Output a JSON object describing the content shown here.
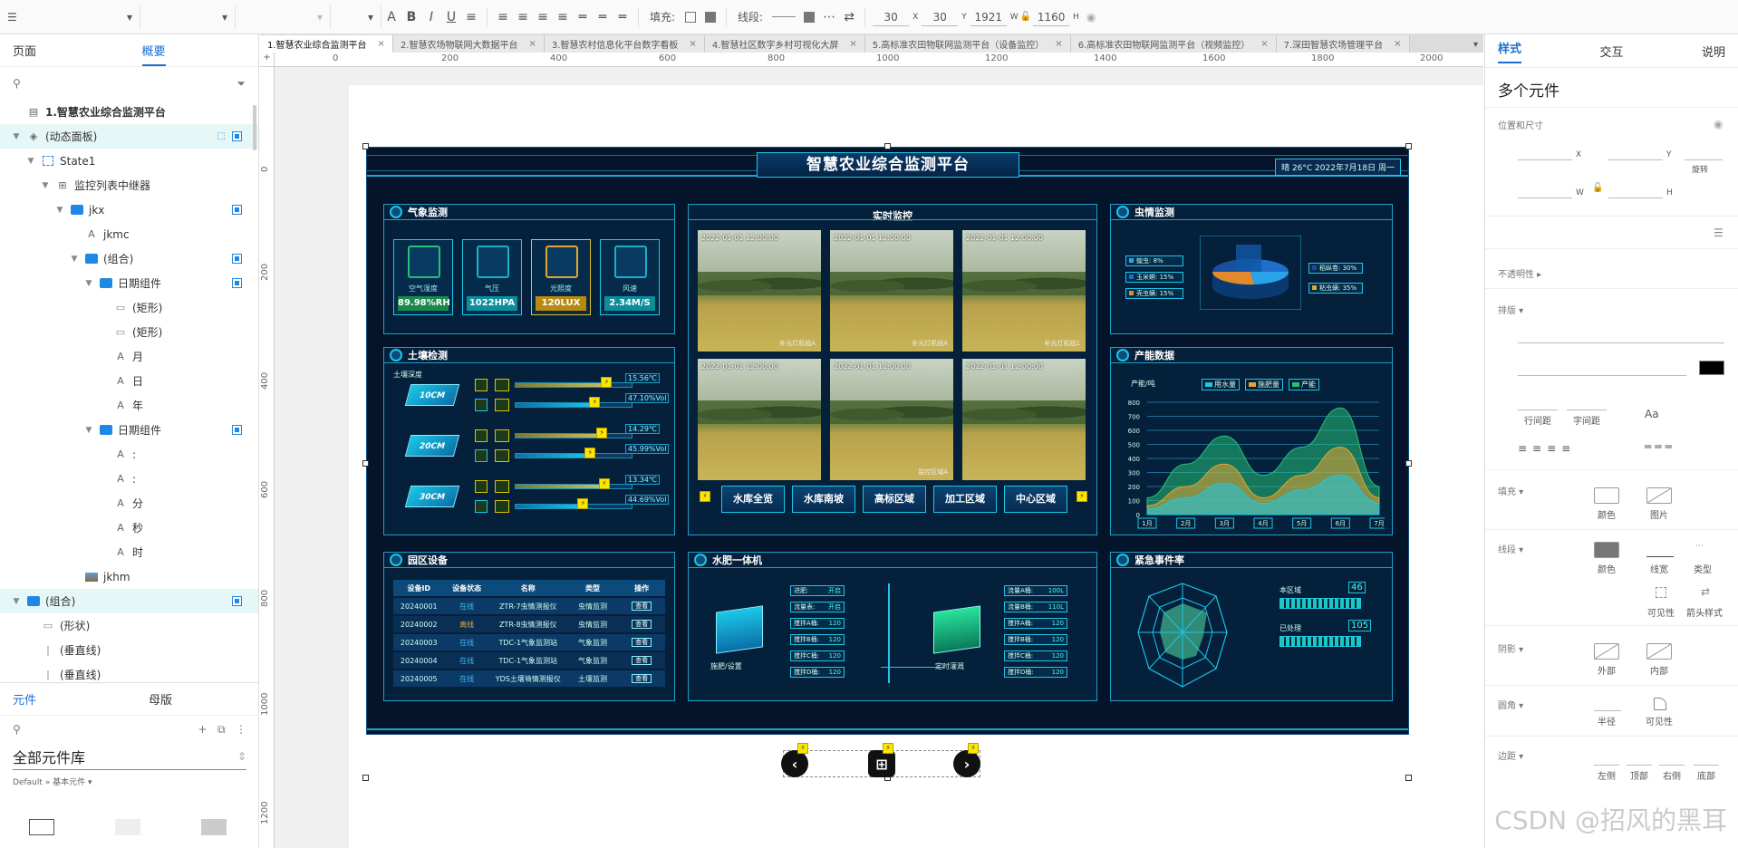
{
  "toolbar": {
    "fill_label": "填充:",
    "line_label": "线段:",
    "x": "30",
    "x_label": "X",
    "y": "30",
    "y_label": "Y",
    "w": "1921",
    "w_label": "W",
    "h": "1160",
    "h_label": "H"
  },
  "left": {
    "tabs": [
      "页面",
      "概要"
    ],
    "tree": [
      {
        "label": "1.智慧农业综合监测平台",
        "bold": true
      },
      {
        "label": "(动态面板)"
      },
      {
        "label": "State1"
      },
      {
        "label": "监控列表中继器"
      },
      {
        "label": "jkx"
      },
      {
        "label": "jkmc"
      },
      {
        "label": "(组合)"
      },
      {
        "label": "日期组件"
      },
      {
        "label": "(矩形)"
      },
      {
        "label": "(矩形)"
      },
      {
        "label": "月"
      },
      {
        "label": "日"
      },
      {
        "label": "年"
      },
      {
        "label": "日期组件"
      },
      {
        "label": ":"
      },
      {
        "label": ":"
      },
      {
        "label": "分"
      },
      {
        "label": "秒"
      },
      {
        "label": "时"
      },
      {
        "label": "jkhm"
      },
      {
        "label": "(组合)"
      },
      {
        "label": "(形状)"
      },
      {
        "label": "(垂直线)"
      },
      {
        "label": "(垂直线)"
      }
    ],
    "bottom_tabs": [
      "元件",
      "母版"
    ],
    "library_title": "全部元件库",
    "library_path": "Default » 基本元件 ▾"
  },
  "page_tabs": [
    "1.智慧农业综合监测平台",
    "2.智慧农场物联网大数据平台",
    "3.智慧农村信息化平台数字看板",
    "4.智慧社区数字乡村可视化大屏",
    "5.高标准农田物联网监测平台（设备监控）",
    "6.高标准农田物联网监测平台（视频监控）",
    "7.深田智慧农场管理平台"
  ],
  "ruler_h": [
    "0",
    "200",
    "400",
    "600",
    "800",
    "1000",
    "1200",
    "1400",
    "1600",
    "1800",
    "2000"
  ],
  "ruler_v": [
    "0",
    "200",
    "400",
    "600",
    "800",
    "1000",
    "1200"
  ],
  "dashboard": {
    "title": "智慧农业综合监测平台",
    "weather": "晴 26°C   2022年7月18日 周一",
    "weather_panel": {
      "title": "气象监测",
      "cards": [
        {
          "label": "空气湿度",
          "value": "89.98%RH"
        },
        {
          "label": "气压",
          "value": "1022HPA"
        },
        {
          "label": "光照度",
          "value": "120LUX"
        },
        {
          "label": "风速",
          "value": "2.34M/S"
        }
      ]
    },
    "soil_panel": {
      "title": "土壤检测",
      "subtitle": "土壤深度",
      "layers": [
        {
          "depth": "10CM",
          "v1": "15.56℃",
          "v2": "47.10%Vol"
        },
        {
          "depth": "20CM",
          "v1": "14.29℃",
          "v2": "45.99%Vol"
        },
        {
          "depth": "30CM",
          "v1": "13.34℃",
          "v2": "44.69%Vol"
        }
      ]
    },
    "camera_panel": {
      "title": "实时监控",
      "timestamp": "2022-01-01 12:00:00",
      "tags": [
        "补光灯机组A",
        "补光灯机组A",
        "补光灯机组1",
        "监控区域A",
        "监控区域A"
      ],
      "zones": [
        "水库全览",
        "水库南坡",
        "高标区域",
        "加工区域",
        "中心区域"
      ]
    },
    "pest_panel": {
      "title": "虫情监测",
      "items": [
        "蝗虫: 8%",
        "玉米螟: 15%",
        "壳虫螨: 15%",
        "稻纵卷: 30%",
        "粘虫螨: 35%"
      ]
    },
    "output_panel": {
      "title": "产能数据",
      "subtitle": "产能/吨",
      "legend": [
        "用水量",
        "施肥量",
        "产能"
      ],
      "yticks": [
        "800",
        "700",
        "600",
        "500",
        "400",
        "300",
        "200",
        "100",
        "0"
      ],
      "months": [
        "1月",
        "2月",
        "3月",
        "4月",
        "5月",
        "6月",
        "7月"
      ]
    },
    "device_panel": {
      "title": "园区设备",
      "headers": [
        "设备ID",
        "设备状态",
        "名称",
        "类型",
        "操作"
      ],
      "rows": [
        [
          "20240001",
          "在线",
          "ZTR-7虫情测报仪",
          "虫情监测",
          "查看"
        ],
        [
          "20240002",
          "离线",
          "ZTR-8虫情测报仪",
          "虫情监测",
          "查看"
        ],
        [
          "20240003",
          "在线",
          "TDC-1气象监测站",
          "气象监测",
          "查看"
        ],
        [
          "20240004",
          "在线",
          "TDC-1气象监测站",
          "气象监测",
          "查看"
        ],
        [
          "20240005",
          "在线",
          "YDS土壤墒情测报仪",
          "土壤监测",
          "查看"
        ]
      ]
    },
    "fert_panel": {
      "title": "水肥一体机",
      "left_label": "施肥/设置",
      "right_label": "定时灌溉",
      "left_items": [
        [
          "进肥:",
          "开启"
        ],
        [
          "流量表:",
          "开启"
        ],
        [
          "搅拌A桶:",
          "120"
        ],
        [
          "搅拌B桶:",
          "120"
        ],
        [
          "搅拌C桶:",
          "120"
        ],
        [
          "搅拌D桶:",
          "120"
        ]
      ],
      "right_items": [
        [
          "流量A桶:",
          "100L"
        ],
        [
          "流量B桶:",
          "110L"
        ],
        [
          "搅拌A桶:",
          "120"
        ],
        [
          "搅拌B桶:",
          "120"
        ],
        [
          "搅拌C桶:",
          "120"
        ],
        [
          "搅拌D桶:",
          "120"
        ]
      ]
    },
    "emergency_panel": {
      "title": "紧急事件率",
      "bars": [
        {
          "label": "本区域",
          "value": "46"
        },
        {
          "label": "已处理",
          "value": "105"
        }
      ]
    }
  },
  "right": {
    "tabs": [
      "样式",
      "交互",
      "说明"
    ],
    "title": "多个元件",
    "sections": {
      "pos": "位置和尺寸",
      "x": "X",
      "y": "Y",
      "rot": "旋转",
      "w": "W",
      "h": "H",
      "opacity": "不透明性 ▸",
      "typo": "排版 ▾",
      "line_spacing": "行间距",
      "char_spacing": "字间距",
      "fill": "填充 ▾",
      "fill_color": "颜色",
      "fill_image": "图片",
      "line": "线段 ▾",
      "line_color": "颜色",
      "line_width": "线宽",
      "line_type": "类型",
      "visible": "可见性",
      "arrow": "箭头样式",
      "shadow": "阴影 ▾",
      "outer": "外部",
      "inner": "内部",
      "radius": "圆角 ▾",
      "radius_half": "半径",
      "radius_vis": "可见性",
      "padding": "边距 ▾",
      "pad_left": "左侧",
      "pad_top": "顶部",
      "pad_right": "右侧",
      "pad_bottom": "底部"
    }
  },
  "watermark": "CSDN @招风的黑耳"
}
